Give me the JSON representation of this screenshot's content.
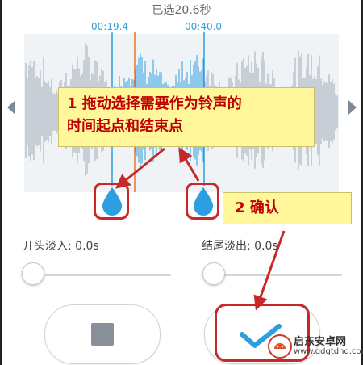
{
  "header": {
    "selected_duration": "已选20.6秒"
  },
  "waveform": {
    "start_time": "00:19.4",
    "end_time": "00:40.0",
    "colors": {
      "background": "#f0f3f6",
      "bars": "#9ea9b6",
      "selected_bars": "#2d9ee0",
      "playhead": "#e8762c",
      "handle": "#2d9ee0"
    }
  },
  "annotations": {
    "callout_1": "1 拖动选择需要作为铃声的\n时间起点和结束点",
    "callout_2": "2 确认",
    "colors": {
      "callout_bg": "#fff799",
      "callout_text": "#c00000",
      "arrow": "#c8282a"
    }
  },
  "fade": {
    "in_label": "开头淡入: 0.0s",
    "out_label": "结尾淡出: 0.0s",
    "in_value": 0,
    "out_value": 0
  },
  "controls": {
    "stop_icon": "stop-square-icon",
    "confirm_icon": "checkmark-icon"
  },
  "watermark": {
    "name": "启东安卓网",
    "url": "www.qdgtdnd.com"
  }
}
